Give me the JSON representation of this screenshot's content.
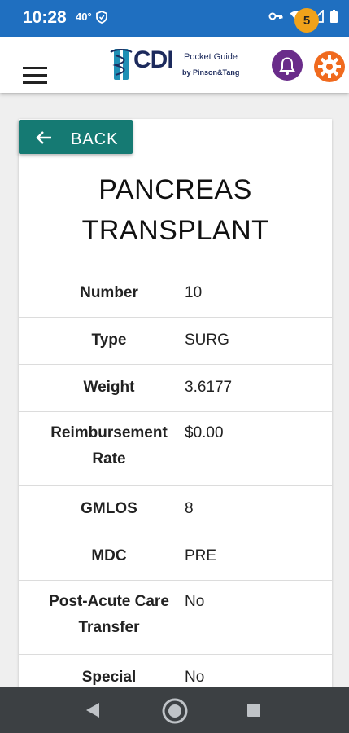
{
  "status_bar": {
    "time": "10:28",
    "temperature": "40°",
    "icons": [
      "shield-icon",
      "key-icon",
      "wifi-icon",
      "signal-icon",
      "battery-icon"
    ]
  },
  "app_bar": {
    "logo_text": "CDI",
    "logo_subtitle": "Pocket Guide",
    "logo_by": "by Pinson&Tang",
    "notification_count": "5",
    "colors": {
      "accent": "#157a73",
      "brand_purple": "#6a2c8a",
      "badge": "#f0a21a",
      "gear": "#f06a1e"
    }
  },
  "back_button": {
    "label": "BACK"
  },
  "detail": {
    "title_line1": "PANCREAS",
    "title_line2": "TRANSPLANT",
    "rows": [
      {
        "label": "Number",
        "value": "10"
      },
      {
        "label": "Type",
        "value": "SURG"
      },
      {
        "label": "Weight",
        "value": "3.6177"
      },
      {
        "label": "Reimbursement Rate",
        "value": "$0.00"
      },
      {
        "label": "GMLOS",
        "value": "8"
      },
      {
        "label": "MDC",
        "value": "PRE"
      },
      {
        "label": "Post-Acute Care Transfer",
        "value": "No"
      },
      {
        "label": "Special",
        "value": "No"
      }
    ]
  }
}
